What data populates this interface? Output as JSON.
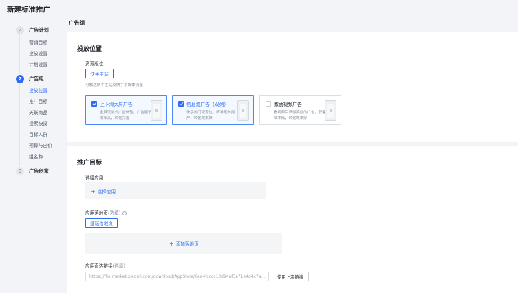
{
  "page": {
    "title": "新建标准推广"
  },
  "steps": [
    {
      "title": "广告计划",
      "state": "done",
      "marker": "✓",
      "items": [
        "营销目标",
        "投放设置",
        "计划设置"
      ]
    },
    {
      "title": "广告组",
      "state": "active",
      "marker": "2",
      "items": [
        "投放位置",
        "推广目标",
        "关联商品",
        "搜索快投",
        "目标人群",
        "预算与出价",
        "组名称"
      ],
      "current_item": "投放位置"
    },
    {
      "title": "广告创意",
      "state": "todo",
      "marker": "3",
      "items": []
    }
  ],
  "main": {
    "group_label": "广告组",
    "placement": {
      "title": "投放位置",
      "resource_label": "资源版位",
      "resource_button": "快手主站",
      "resource_hint": "可触达快手主站及快手系媒体流量",
      "cards": [
        {
          "title": "上下滑大屏广告",
          "desc": "全屏沉浸式广告体验，广告展示效率高，转化完善",
          "checked": true
        },
        {
          "title": "信息流广告（双列）",
          "desc": "快手热门资源位，精准定向用户，转化效果好",
          "checked": true
        },
        {
          "title": "激励视频广告",
          "desc": "看视频后获得奖励的广告，获客成本低，转化效果好",
          "checked": false
        }
      ]
    },
    "target": {
      "title": "推广目标",
      "app_label": "选择应用",
      "app_add": "选择应用",
      "landing_label": "应用落地页",
      "landing_optional": "(选填)",
      "landing_help_icon": "question-circle-icon",
      "landing_create_button": "建站落地页",
      "landing_add": "添加落地页",
      "link_label": "应用直达链接",
      "link_optional": "(选填)",
      "link_value": "https://file.market.xiaomi.com/download/AppStore/0ea4fcccc13d94af3a71e4d4c7a...",
      "link_reuse_button": "使用上次链接"
    }
  },
  "colors": {
    "accent": "#2f6cf6",
    "background": "#f3f4f7",
    "panel": "#ffffff"
  }
}
